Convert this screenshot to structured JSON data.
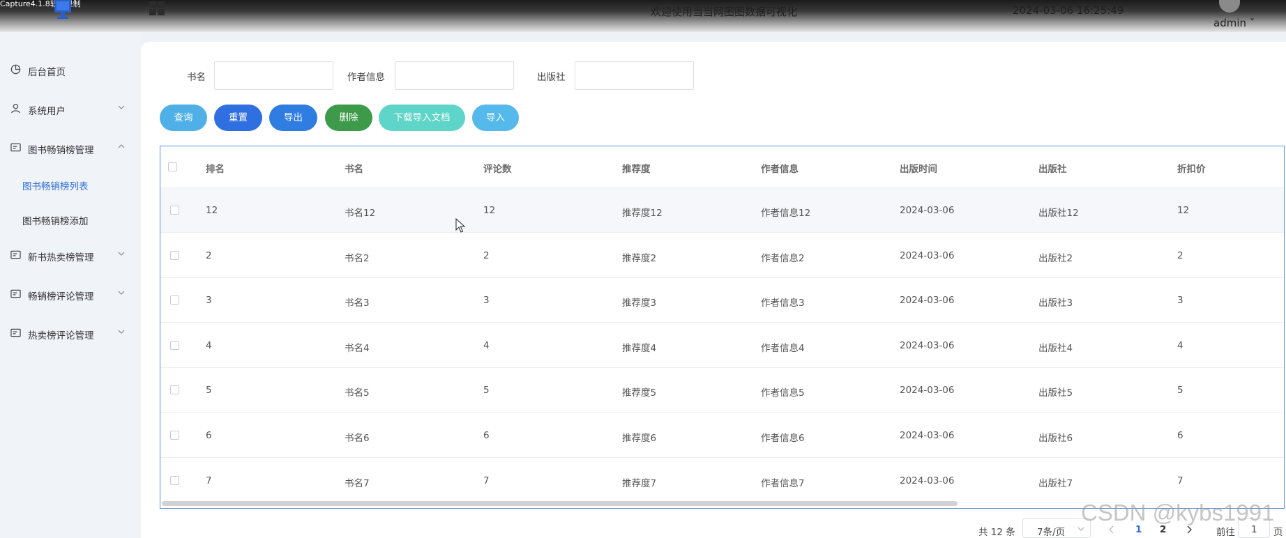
{
  "header": {
    "capture_label": "Capture4.1.8软件录制",
    "title": "欢迎使用当当网图图数据可视化",
    "datetime": "2024-03-06 16:25:49",
    "user": "admin ˅"
  },
  "sidebar": {
    "items": [
      {
        "label": "后台首页",
        "icon": "pie-chart-icon"
      },
      {
        "label": "系统用户",
        "icon": "user-icon"
      },
      {
        "label": "图书畅销榜管理",
        "icon": "card-icon",
        "expanded": true,
        "children": [
          {
            "label": "图书畅销榜列表",
            "active": true
          },
          {
            "label": "图书畅销榜添加",
            "active": false
          }
        ]
      },
      {
        "label": "新书热卖榜管理",
        "icon": "card-icon"
      },
      {
        "label": "畅销榜评论管理",
        "icon": "card-icon"
      },
      {
        "label": "热卖榜评论管理",
        "icon": "card-icon"
      }
    ],
    "active_color": "#2f6fd6"
  },
  "search": {
    "fields": [
      {
        "label": "书名",
        "value": ""
      },
      {
        "label": "作者信息",
        "value": ""
      },
      {
        "label": "出版社",
        "value": ""
      }
    ]
  },
  "buttons": [
    {
      "label": "查询",
      "color": "#4fb0e8"
    },
    {
      "label": "重置",
      "color": "#2f6fe0"
    },
    {
      "label": "导出",
      "color": "#2f7de0"
    },
    {
      "label": "删除",
      "color": "#3d9a4a"
    },
    {
      "label": "下载导入文档",
      "color": "#5fd4c8"
    },
    {
      "label": "导入",
      "color": "#56b9ec"
    }
  ],
  "table": {
    "columns": [
      "排名",
      "书名",
      "评论数",
      "推荐度",
      "作者信息",
      "出版时间",
      "出版社",
      "折扣价"
    ],
    "rows": [
      [
        "12",
        "书名12",
        "12",
        "推荐度12",
        "作者信息12",
        "2024-03-06",
        "出版社12",
        "12"
      ],
      [
        "2",
        "书名2",
        "2",
        "推荐度2",
        "作者信息2",
        "2024-03-06",
        "出版社2",
        "2"
      ],
      [
        "3",
        "书名3",
        "3",
        "推荐度3",
        "作者信息3",
        "2024-03-06",
        "出版社3",
        "3"
      ],
      [
        "4",
        "书名4",
        "4",
        "推荐度4",
        "作者信息4",
        "2024-03-06",
        "出版社4",
        "4"
      ],
      [
        "5",
        "书名5",
        "5",
        "推荐度5",
        "作者信息5",
        "2024-03-06",
        "出版社5",
        "5"
      ],
      [
        "6",
        "书名6",
        "6",
        "推荐度6",
        "作者信息6",
        "2024-03-06",
        "出版社6",
        "6"
      ],
      [
        "7",
        "书名7",
        "7",
        "推荐度7",
        "作者信息7",
        "2024-03-06",
        "出版社7",
        "7"
      ]
    ]
  },
  "pagination": {
    "total": "共 12 条",
    "page_size": "7条/页",
    "pages": [
      "1",
      "2"
    ],
    "current_page": "1",
    "goto_label": "前往",
    "goto_value": "1",
    "page_suffix": "页"
  },
  "watermark": "CSDN @kybs1991"
}
